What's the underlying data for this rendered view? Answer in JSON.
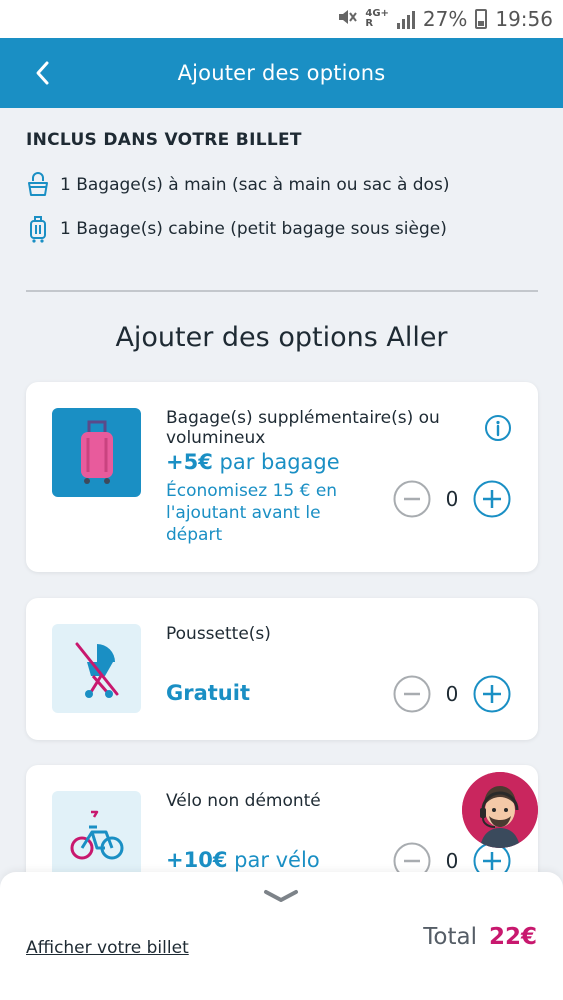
{
  "status_bar": {
    "network": "4G+",
    "roaming": "R",
    "battery": "27%",
    "time": "19:56"
  },
  "header": {
    "title": "Ajouter des options"
  },
  "included": {
    "heading": "INCLUS DANS VOTRE BILLET",
    "items": [
      {
        "icon": "handbag-icon",
        "label": "1 Bagage(s) à main (sac à main ou sac à dos)"
      },
      {
        "icon": "cabin-luggage-icon",
        "label": "1 Bagage(s) cabine (petit bagage sous siège)"
      }
    ]
  },
  "options_title": "Ajouter des options Aller",
  "options": [
    {
      "icon": "pink-suitcase-icon",
      "name": "Bagage(s) supplémentaire(s) ou volumineux",
      "price": "+5€",
      "price_unit": "par bagage",
      "note": "Économisez 15 € en l'ajoutant avant le départ",
      "quantity": "0",
      "has_info": true
    },
    {
      "icon": "stroller-crossed-icon",
      "name": "Poussette(s)",
      "price": "Gratuit",
      "price_unit": "",
      "note": "",
      "quantity": "0",
      "has_info": false
    },
    {
      "icon": "bicycle-icon",
      "name": "Vélo non démonté",
      "price": "+10€",
      "price_unit": "par vélo",
      "note": "",
      "quantity": "0",
      "has_info": false
    }
  ],
  "footer": {
    "link": "Afficher votre billet",
    "total_label": "Total",
    "total_value": "22€"
  },
  "colors": {
    "primary": "#1a8fc4",
    "accent": "#c8186e",
    "background": "#eef1f5"
  }
}
